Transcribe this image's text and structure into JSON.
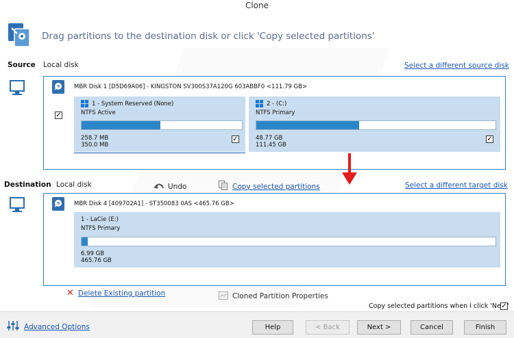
{
  "window": {
    "title": "Clone"
  },
  "header": {
    "instruction": "Drag partitions to the destination disk or click 'Copy selected partitions'"
  },
  "source": {
    "label": "Source",
    "sub_label": "Local disk",
    "select_link": "Select a different source disk",
    "disk_title": "MBR Disk 1 [D5D69A06] - KINGSTON SV300S37A120G 603ABBF0  <111.79 GB>",
    "disk_checked": true,
    "partitions": [
      {
        "name": "1 - System Reserved (None)",
        "type": "NTFS Active",
        "used": "258.7 MB",
        "total": "350.0 MB",
        "fill": 0.49,
        "checked": true
      },
      {
        "name": "2 -  (C:)",
        "type": "NTFS Primary",
        "used": "48.77 GB",
        "total": "111.45 GB",
        "fill": 0.43,
        "checked": true
      }
    ]
  },
  "destination": {
    "label": "Destination",
    "sub_label": "Local disk",
    "undo_label": "Undo",
    "copy_link": "Copy selected partitions",
    "select_link": "Select a different target disk",
    "disk_title": "MBR Disk 4 [409702A1] - ST350083 0AS  <465.76 GB>",
    "partition": {
      "name": "1 - LaCie (E:)",
      "type": "NTFS Primary",
      "used": "6.99 GB",
      "total": "465.76 GB",
      "fill": 0.015
    }
  },
  "actions": {
    "delete_link": "Delete Existing partition",
    "properties_label": "Cloned Partition Properties",
    "copy_on_next_label": "Copy selected partitions when I click 'Next'",
    "copy_on_next_checked": true
  },
  "footer": {
    "advanced_link": "Advanced Options",
    "buttons": {
      "help": "Help",
      "back": "< Back",
      "next": "Next >",
      "cancel": "Cancel",
      "finish": "Finish"
    }
  },
  "colors": {
    "accent": "#2a82c7",
    "partition_bg": "#c8ddef",
    "bar_fill": "#2b86c9",
    "arrow": "#e31b1b",
    "link": "#1a56b3"
  },
  "icons": [
    "clone-icon",
    "monitor-icon",
    "disk-icon",
    "windows-icon",
    "undo-icon",
    "copy-icon",
    "delete-x-icon",
    "properties-icon",
    "settings-sliders-icon",
    "arrow-down-icon"
  ]
}
